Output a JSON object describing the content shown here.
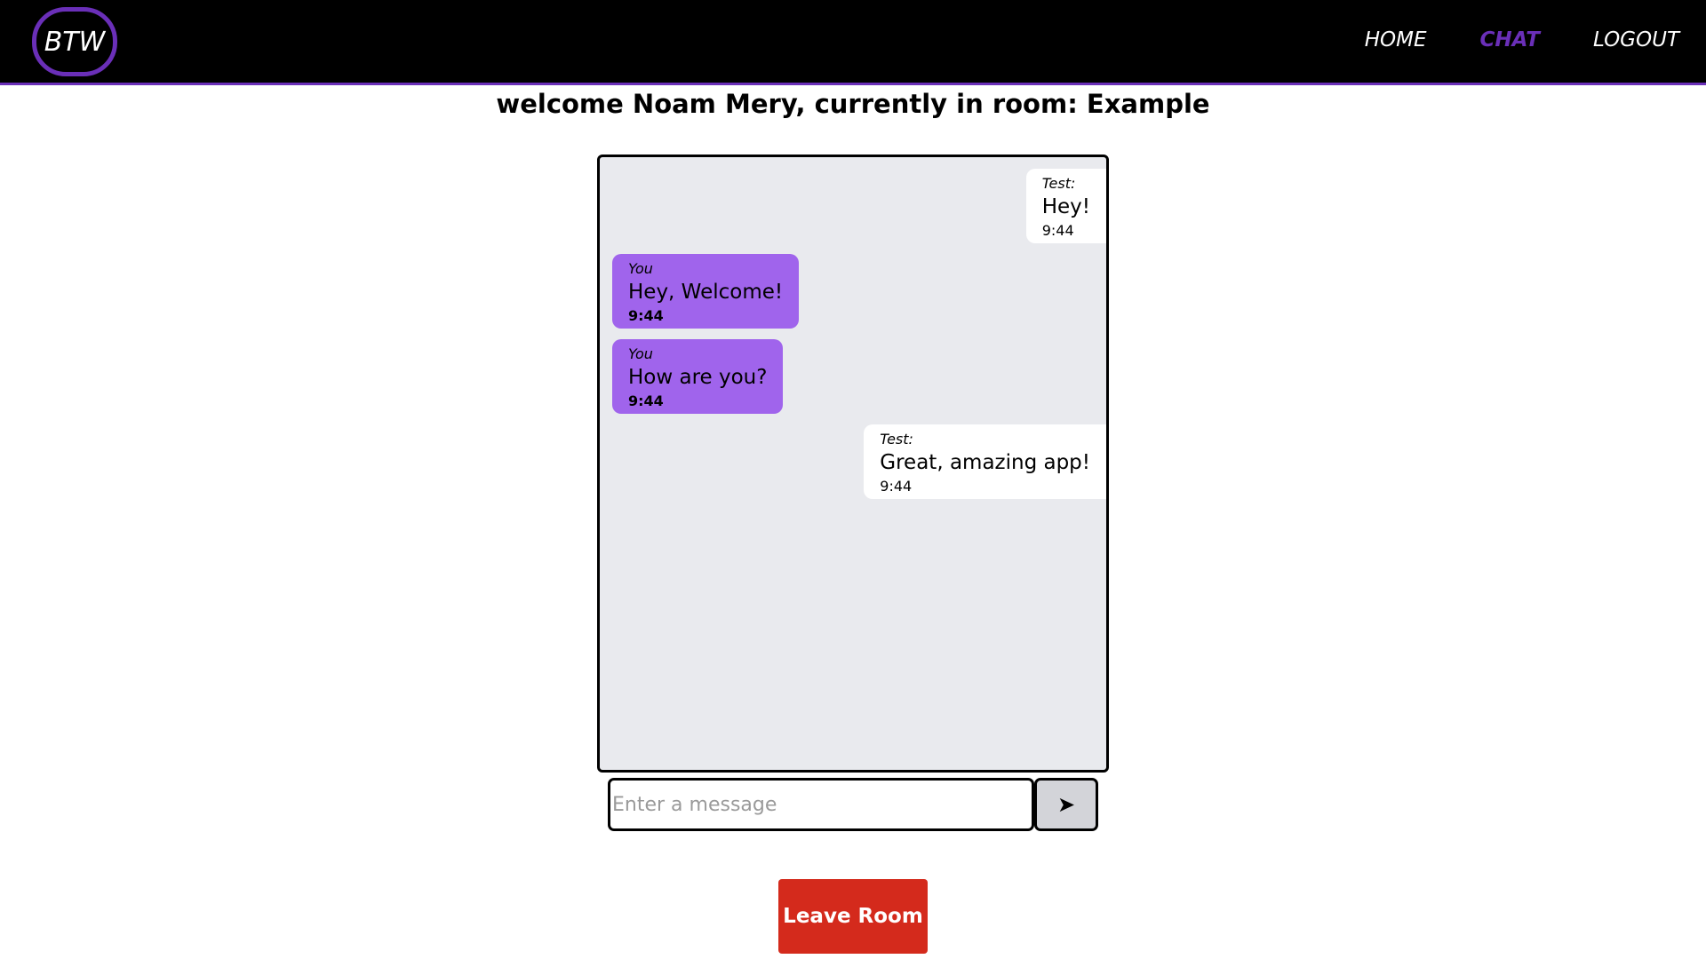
{
  "navbar": {
    "logo_text": "BTW",
    "links": [
      {
        "label": "HOME",
        "active": false
      },
      {
        "label": "CHAT",
        "active": true
      },
      {
        "label": "LOGOUT",
        "active": false
      }
    ],
    "accent_color": "#6a2fb8"
  },
  "welcome_text": "welcome Noam Mery, currently in room: Example",
  "chat": {
    "messages": [
      {
        "sender": "Test:",
        "text": "Hey!",
        "time": "9:44",
        "mine": false
      },
      {
        "sender": "You",
        "text": "Hey, Welcome!",
        "time": "9:44",
        "mine": true
      },
      {
        "sender": "You",
        "text": "How are you?",
        "time": "9:44",
        "mine": true
      },
      {
        "sender": "Test:",
        "text": "Great, amazing app!",
        "time": "9:44",
        "mine": false
      }
    ],
    "my_bubble_color": "#a064ec",
    "other_bubble_color": "#ffffff"
  },
  "composer": {
    "placeholder": "Enter a message",
    "value": "",
    "send_icon": "send-arrow-icon",
    "send_glyph": "➤"
  },
  "leave_button_label": "Leave Room",
  "leave_button_color": "#d42a1c"
}
